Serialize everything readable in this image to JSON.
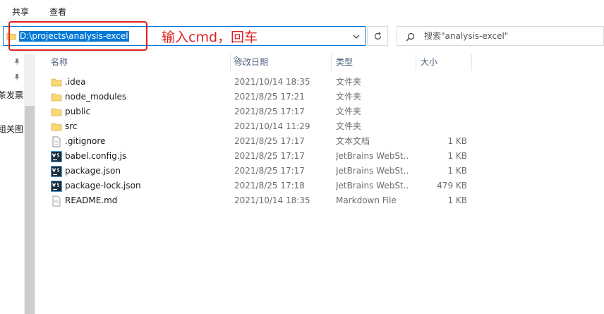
{
  "ribbon": {
    "tabs": [
      "共享",
      "查看"
    ]
  },
  "address": {
    "path": "D:\\projects\\analysis-excel"
  },
  "search": {
    "placeholder": "搜索\"analysis-excel\""
  },
  "annotation": {
    "text": "输入cmd，回车",
    "color": "#e02020"
  },
  "nav_pane": {
    "fragments": [
      "茶发票",
      "组关图,"
    ]
  },
  "columns": {
    "name": "名称",
    "date": "修改日期",
    "type": "类型",
    "size": "大小"
  },
  "files": [
    {
      "name": ".idea",
      "date": "2021/10/14 18:35",
      "type": "文件夹",
      "size": "",
      "icon": "folder-icon"
    },
    {
      "name": "node_modules",
      "date": "2021/8/25 17:21",
      "type": "文件夹",
      "size": "",
      "icon": "folder-icon"
    },
    {
      "name": "public",
      "date": "2021/8/25 17:17",
      "type": "文件夹",
      "size": "",
      "icon": "folder-icon"
    },
    {
      "name": "src",
      "date": "2021/10/14 11:29",
      "type": "文件夹",
      "size": "",
      "icon": "folder-icon"
    },
    {
      "name": ".gitignore",
      "date": "2021/8/25 17:17",
      "type": "文本文档",
      "size": "1 KB",
      "icon": "text-file-icon"
    },
    {
      "name": "babel.config.js",
      "date": "2021/8/25 17:17",
      "type": "JetBrains WebSt...",
      "size": "1 KB",
      "icon": "webstorm-file-icon"
    },
    {
      "name": "package.json",
      "date": "2021/8/25 17:17",
      "type": "JetBrains WebSt...",
      "size": "1 KB",
      "icon": "webstorm-file-icon"
    },
    {
      "name": "package-lock.json",
      "date": "2021/8/25 17:18",
      "type": "JetBrains WebSt...",
      "size": "479 KB",
      "icon": "webstorm-file-icon"
    },
    {
      "name": "README.md",
      "date": "2021/10/14 18:35",
      "type": "Markdown File",
      "size": "1 KB",
      "icon": "markdown-file-icon"
    }
  ],
  "colors": {
    "accent": "#0078d7",
    "folder": "#f8d775",
    "header_text": "#4c607a",
    "annotation": "#e02020"
  }
}
